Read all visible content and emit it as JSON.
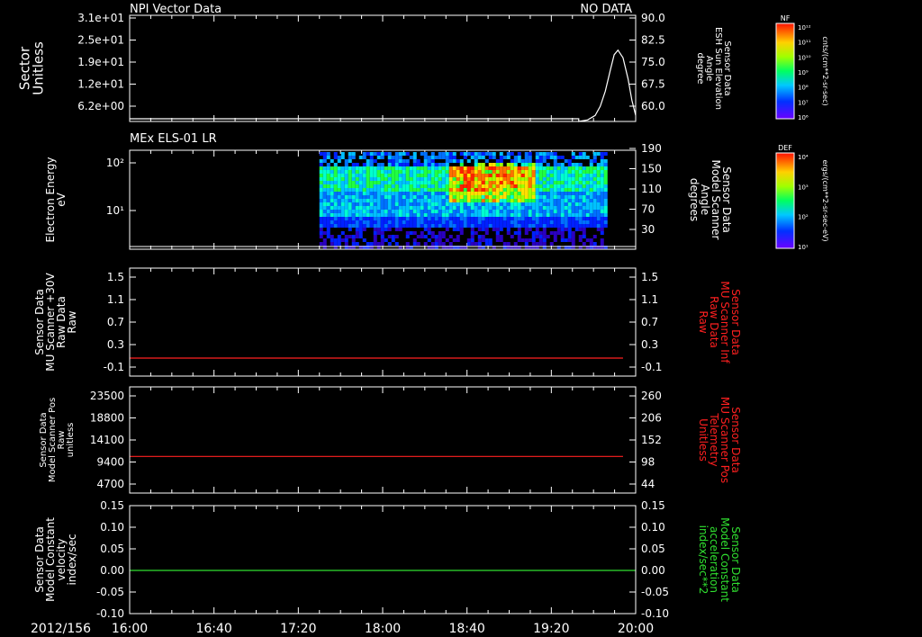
{
  "colors": {
    "background": "#000000",
    "axes": "#ffffff",
    "red": "#ff2020",
    "green": "#30e030"
  },
  "header": {
    "left_title": "NPI Vector Data",
    "right_title": "NO DATA"
  },
  "panel2_title": "MEx ELS-01 LR",
  "x_axis": {
    "date_label": "2012/156",
    "ticks": [
      "16:00",
      "16:40",
      "17:20",
      "18:00",
      "18:40",
      "19:20",
      "20:00"
    ],
    "tick_hours": [
      16,
      16.6667,
      17.3333,
      18,
      18.6667,
      19.3333,
      20
    ],
    "range_hours": [
      16,
      20
    ]
  },
  "colorbars": [
    {
      "title": "NF",
      "unit": "cnts/(cm**2-sr-sec)",
      "ticks": [
        "10¹²",
        "10¹¹",
        "10¹⁰",
        "10⁹",
        "10⁸",
        "10⁷",
        "10⁶"
      ]
    },
    {
      "title": "DEF",
      "unit": "ergs/(cm**2-sr-sec-eV)",
      "ticks": [
        "10⁴",
        "10³",
        "10²",
        "10¹"
      ]
    }
  ],
  "chart_data": [
    {
      "type": "line",
      "left_ylabel": [
        "Sector",
        "Unitless"
      ],
      "left_ticks": [
        "3.1e+01",
        "2.5e+01",
        "1.9e+01",
        "1.2e+01",
        "6.2e+00"
      ],
      "right_ylabel": [
        "Sensor Data",
        "ESH Sun Elevation",
        "Angle",
        "degree"
      ],
      "right_ticks": [
        "90.0",
        "82.5",
        "75.0",
        "67.5",
        "60.0"
      ],
      "ylim_right": [
        55,
        90
      ],
      "series": [
        {
          "x": [
            19.55,
            19.62,
            19.68,
            19.72,
            19.76,
            19.8,
            19.83,
            19.86,
            19.9,
            19.94,
            19.97,
            20.0
          ],
          "y": [
            55.0,
            55.5,
            57.0,
            60.0,
            65.0,
            72.0,
            77.0,
            78.5,
            76.0,
            69.0,
            62.0,
            57.0
          ]
        }
      ]
    },
    {
      "type": "heatmap",
      "left_ylabel": [
        "Electron Energy",
        "eV"
      ],
      "left_ticks": [
        "10²",
        "10¹"
      ],
      "right_ylabel": [
        "Sensor Data",
        "Model Scanner",
        "Angle",
        "degrees"
      ],
      "right_ticks": [
        "190",
        "150",
        "110",
        "70",
        "30"
      ],
      "data_x_range": [
        17.5,
        19.75
      ],
      "ylim_right": [
        10,
        190
      ]
    },
    {
      "type": "line",
      "left_ylabel": [
        "Sensor Data",
        "MU Scanner +30V",
        "Raw Data",
        "Raw"
      ],
      "left_ticks": [
        "1.5",
        "1.1",
        "0.7",
        "0.3",
        "-0.1"
      ],
      "right_ylabel": [
        "Sensor Data",
        "MU Scanner Inf",
        "Raw Data",
        "Raw"
      ],
      "right_ticks": [
        "1.5",
        "1.1",
        "0.7",
        "0.3",
        "-0.1"
      ],
      "ylim": [
        -0.3,
        1.5
      ],
      "series": [
        {
          "x": [
            16.0,
            19.9
          ],
          "y": [
            0.0,
            0.0
          ]
        }
      ]
    },
    {
      "type": "line",
      "left_ylabel": [
        "Sensor Data",
        "Model Scanner Pos",
        "Raw",
        "unitless"
      ],
      "left_ticks": [
        "23500",
        "18800",
        "14100",
        "9400",
        "4700"
      ],
      "right_ylabel": [
        "Sensor Data",
        "MU Scanner Pos",
        "Telemetry",
        "Unitless"
      ],
      "right_ticks": [
        "260",
        "206",
        "152",
        "98",
        "44"
      ],
      "ylim": [
        0,
        23500
      ],
      "series": [
        {
          "x": [
            16.0,
            19.9
          ],
          "y": [
            8100,
            8100
          ]
        }
      ]
    },
    {
      "type": "line",
      "left_ylabel": [
        "Sensor Data",
        "Model Constant",
        "velocity",
        "index/sec"
      ],
      "left_ticks": [
        "0.15",
        "0.10",
        "0.05",
        "0.00",
        "-0.05",
        "-0.10"
      ],
      "right_ylabel": [
        "Sensor Data",
        "Model Constant",
        "acceleration",
        "index/sec**2"
      ],
      "right_ticks": [
        "0.15",
        "0.10",
        "0.05",
        "0.00",
        "-0.05",
        "-0.10"
      ],
      "ylim": [
        -0.1,
        0.15
      ],
      "series": [
        {
          "x": [
            16.0,
            20.0
          ],
          "y": [
            0.0,
            0.0
          ]
        }
      ]
    }
  ]
}
